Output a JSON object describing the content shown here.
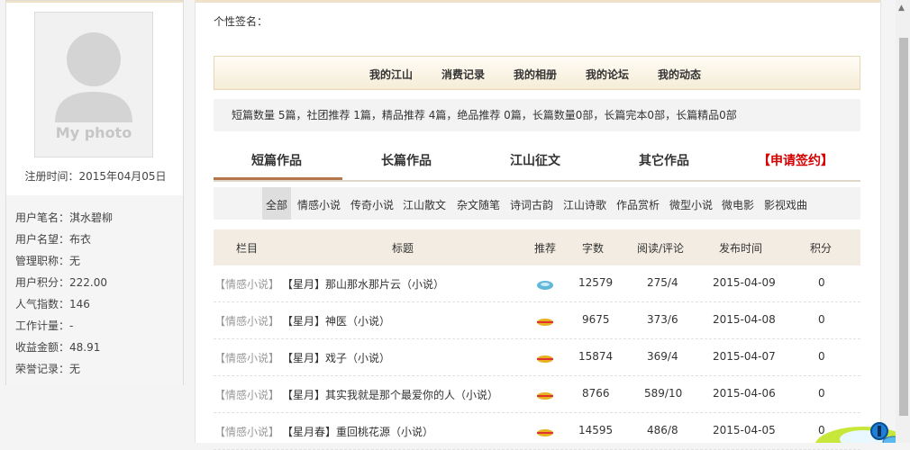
{
  "profile": {
    "photo_label": "My photo",
    "reg_time": "注册时间：2015年04月05日",
    "stats": [
      "用户笔名：淇水碧柳",
      "用户名望：布衣",
      "管理职称：无",
      "用户积分：222.00",
      "人气指数：146",
      "工作计量：-",
      "收益金额：48.91",
      "荣誉记录：无"
    ]
  },
  "signature_label": "个性签名：",
  "nav": [
    "我的江山",
    "消费记录",
    "我的相册",
    "我的论坛",
    "我的动态"
  ],
  "summary": "短篇数量 5篇，社团推荐 1篇，精品推荐 4篇，绝品推荐 0篇，长篇数量0部，长篇完本0部，长篇精品0部",
  "tabs": [
    "短篇作品",
    "长篇作品",
    "江山征文",
    "其它作品",
    "【申请签约】"
  ],
  "categories": [
    "全部",
    "情感小说",
    "传奇小说",
    "江山散文",
    "杂文随笔",
    "诗词古韵",
    "江山诗歌",
    "作品赏析",
    "微型小说",
    "微电影",
    "影视戏曲"
  ],
  "table": {
    "headers": [
      "栏目",
      "标题",
      "推荐",
      "字数",
      "阅读/评论",
      "发布时间",
      "积分"
    ],
    "rows": [
      {
        "cat": "【情感小说】",
        "title": "【星月】那山那水那片云（小说）",
        "rec": "jade",
        "words": "12579",
        "reads": "275/4",
        "date": "2015-04-09",
        "score": "0"
      },
      {
        "cat": "【情感小说】",
        "title": "【星月】神医（小说）",
        "rec": "stripe",
        "words": "9675",
        "reads": "373/6",
        "date": "2015-04-08",
        "score": "0"
      },
      {
        "cat": "【情感小说】",
        "title": "【星月】戏子（小说）",
        "rec": "stripe",
        "words": "15874",
        "reads": "369/4",
        "date": "2015-04-07",
        "score": "0"
      },
      {
        "cat": "【情感小说】",
        "title": "【星月】其实我就是那个最爱你的人（小说）",
        "rec": "stripe",
        "words": "8766",
        "reads": "589/10",
        "date": "2015-04-06",
        "score": "0"
      },
      {
        "cat": "【情感小说】",
        "title": "【星月春】重回桃花源（小说）",
        "rec": "stripe",
        "words": "14595",
        "reads": "486/8",
        "date": "2015-04-05",
        "score": "0"
      }
    ]
  },
  "colors": {
    "accent": "#b4764a",
    "sign": "#d40000",
    "nav_border": "#e7d7b4"
  }
}
